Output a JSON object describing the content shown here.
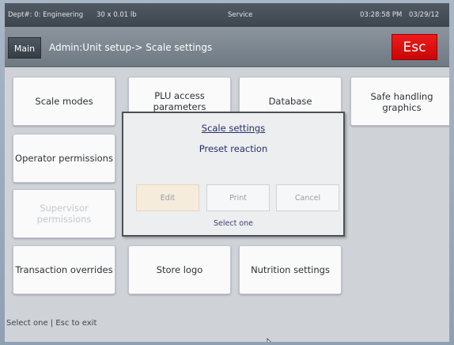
{
  "status_bar": {
    "dept": "Dept#: 0: Engineering",
    "weight": "30 x 0.01 lb",
    "mode": "Service",
    "time": "03:28:58 PM",
    "date": "03/29/12"
  },
  "title_bar": {
    "main_label": "Main",
    "breadcrumb": "Admin:Unit setup-> Scale settings",
    "esc_label": "Esc"
  },
  "tiles": {
    "scale_modes": "Scale modes",
    "plu_access": "PLU access parameters",
    "database": "Database",
    "safe_handling": "Safe handling graphics",
    "operator_permissions": "Operator permissions",
    "supervisor_permissions": "Supervisor permissions",
    "transaction_overrides": "Transaction overrides",
    "store_logo": "Store logo",
    "nutrition_settings": "Nutrition settings"
  },
  "dialog": {
    "title": "Scale settings",
    "subtitle": "Preset reaction",
    "edit_label": "Edit",
    "print_label": "Print",
    "cancel_label": "Cancel",
    "hint": "Select one"
  },
  "footer": {
    "text": "Select one | Esc to exit"
  },
  "colors": {
    "esc_red": "#e31010",
    "dialog_text": "#24306a",
    "status_bg": "#454d55"
  },
  "icons": {
    "cursor": "mouse-pointer-icon"
  }
}
